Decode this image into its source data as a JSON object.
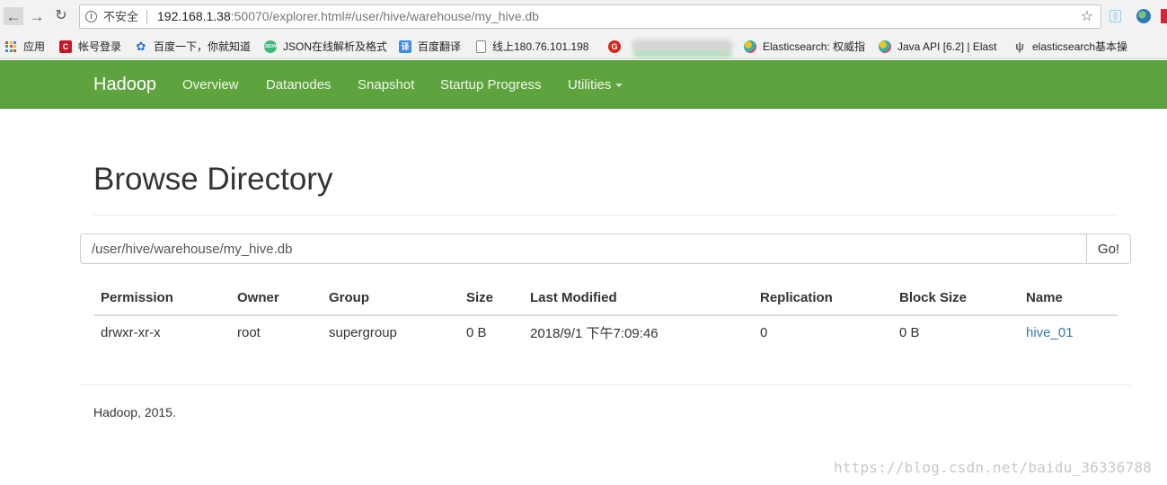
{
  "browser": {
    "insecure_label": "不安全",
    "url_host": "192.168.1.38",
    "url_rest": ":50070/explorer.html#/user/hive/warehouse/my_hive.db",
    "bookmarks": [
      {
        "label": "应用",
        "icon": "apps-grid-icon"
      },
      {
        "label": "帐号登录",
        "icon": "csdn-icon",
        "color": "#c81623"
      },
      {
        "label": "百度一下，你就知道",
        "icon": "baidu-paw-icon",
        "color": "#2d6fe0"
      },
      {
        "label": "JSON在线解析及格式",
        "icon": "json-icon",
        "color": "#3cb878"
      },
      {
        "label": "百度翻译",
        "icon": "translate-icon",
        "color": "#3d8ee6"
      },
      {
        "label": "线上180.76.101.198",
        "icon": "page-icon"
      },
      {
        "label": "",
        "icon": "g-icon",
        "color": "#d9241c"
      },
      {
        "label": "Elasticsearch: 权威指",
        "icon": "elastic-icon"
      },
      {
        "label": "Java API [6.2] | Elast",
        "icon": "elastic-icon"
      },
      {
        "label": "elasticsearch基本操",
        "icon": "elastic-alt-icon"
      }
    ]
  },
  "navbar": {
    "brand": "Hadoop",
    "links": [
      "Overview",
      "Datanodes",
      "Snapshot",
      "Startup Progress",
      "Utilities"
    ],
    "color": "#5fa33e"
  },
  "main": {
    "title": "Browse Directory",
    "path_value": "/user/hive/warehouse/my_hive.db",
    "go_label": "Go!",
    "table": {
      "headers": [
        "Permission",
        "Owner",
        "Group",
        "Size",
        "Last Modified",
        "Replication",
        "Block Size",
        "Name"
      ],
      "rows": [
        [
          "drwxr-xr-x",
          "root",
          "supergroup",
          "0 B",
          "2018/9/1 下午7:09:46",
          "0",
          "0 B",
          "hive_01"
        ]
      ]
    },
    "link_color": "#337ab7"
  },
  "footer": {
    "text": "Hadoop, 2015."
  },
  "watermark": "https://blog.csdn.net/baidu_36336788"
}
